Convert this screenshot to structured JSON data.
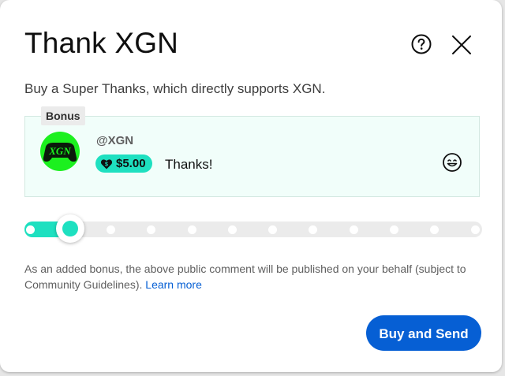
{
  "dialog": {
    "title": "Thank XGN",
    "subtitle": "Buy a Super Thanks, which directly supports XGN.",
    "help_icon": "help-circle-icon",
    "close_icon": "close-icon"
  },
  "comment": {
    "bonus_label": "Bonus",
    "avatar_text": "XGN",
    "handle": "@XGN",
    "amount": "$5.00",
    "text": "Thanks!",
    "emoji_icon": "smiley-icon"
  },
  "slider": {
    "steps": 12,
    "selected_step": 2
  },
  "disclaimer": {
    "text": "As an added bonus, the above public comment will be published on your behalf (subject to Community Guidelines).",
    "link": "Learn more"
  },
  "actions": {
    "buy_label": "Buy and Send"
  },
  "colors": {
    "accent": "#1ee0c0",
    "primary_button": "#065fd4",
    "avatar_bg": "#1cf01f",
    "comment_bg": "#f1fefa"
  }
}
